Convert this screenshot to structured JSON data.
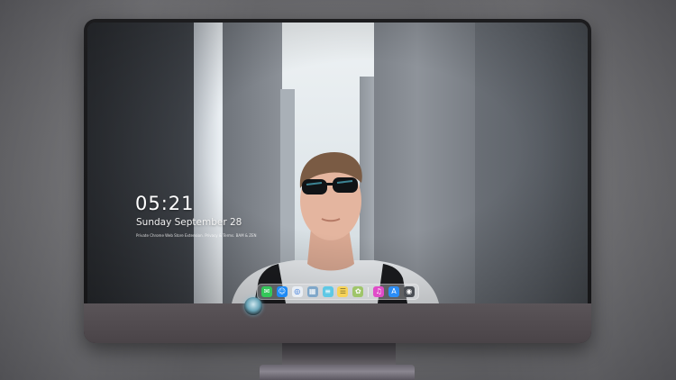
{
  "lock_screen": {
    "time": "05:21",
    "date": "Sunday September 28",
    "notice": "Private Chrome Web Store Extension. Privacy & Terms. BAM & ZEN"
  },
  "dock": {
    "items": [
      {
        "name": "messages-icon",
        "glyph": "✉",
        "color": "#34c759"
      },
      {
        "name": "finder-icon",
        "glyph": "☺",
        "color": "#1e8af5"
      },
      {
        "name": "safari-icon",
        "glyph": "◎",
        "color": "#e9eef4"
      },
      {
        "name": "preview-icon",
        "glyph": "▦",
        "color": "#7fa7c9"
      },
      {
        "name": "reminders-icon",
        "glyph": "≡",
        "color": "#5ec8e5"
      },
      {
        "name": "notes-icon",
        "glyph": "☰",
        "color": "#f6d35a"
      },
      {
        "name": "photos-icon",
        "glyph": "✿",
        "color": "#9fc56a"
      },
      {
        "name": "music-icon",
        "glyph": "♫",
        "color": "#e04cc8"
      },
      {
        "name": "app-store-icon",
        "glyph": "A",
        "color": "#2b8df5"
      },
      {
        "name": "screenshot-icon",
        "glyph": "◉",
        "color": "#4b4f55"
      }
    ]
  }
}
